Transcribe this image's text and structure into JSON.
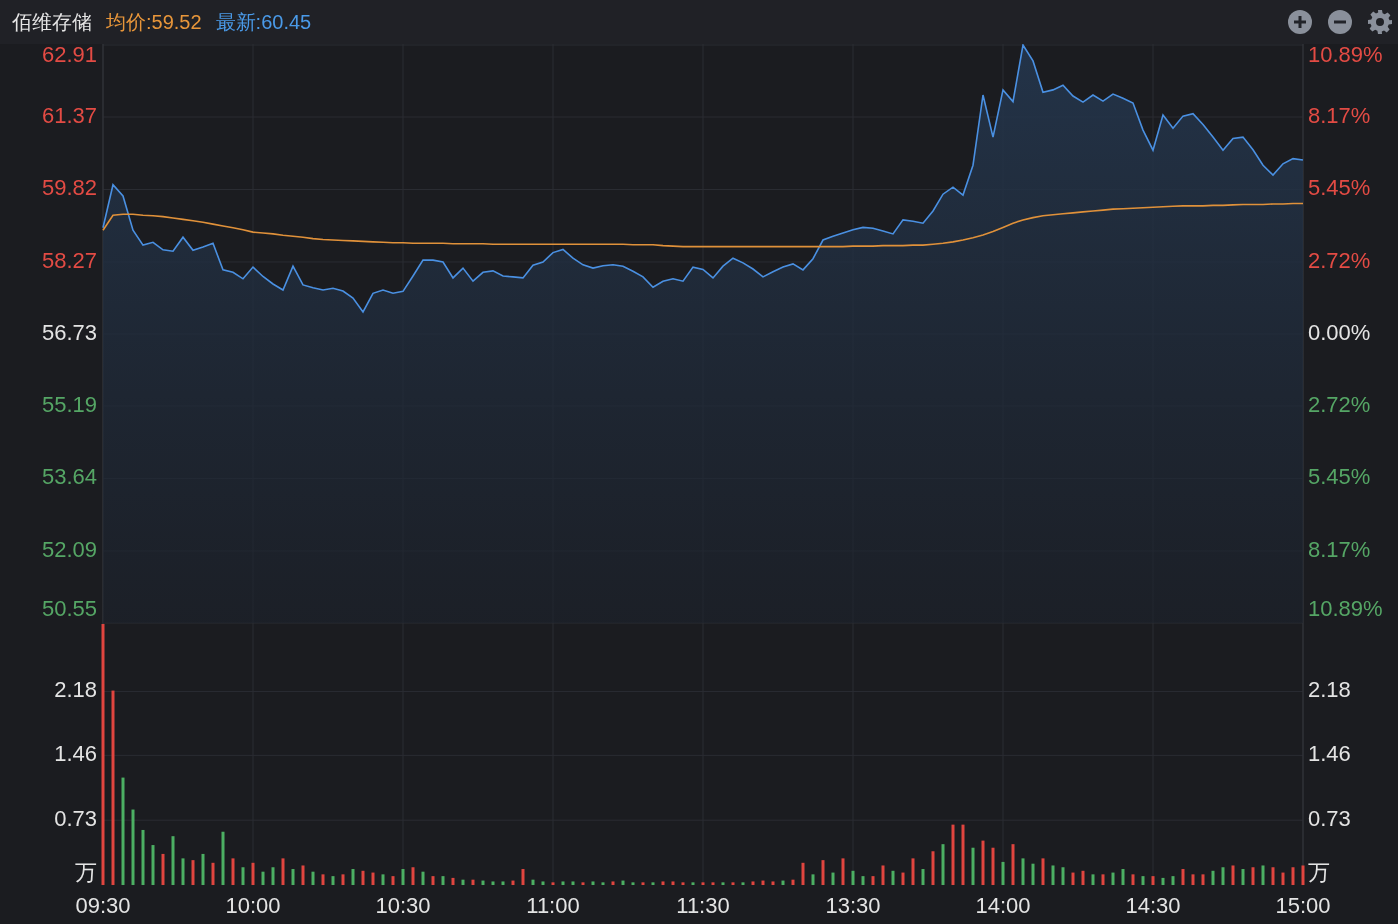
{
  "header": {
    "title": "佰维存储",
    "average": "均价:59.52",
    "latest": "最新:60.45",
    "tools": [
      {
        "kind": "zoom_in"
      },
      {
        "kind": "zoom_out"
      },
      {
        "kind": "settings"
      }
    ]
  },
  "price_chart": {
    "chart_data": {
      "type": "area",
      "grid": true,
      "ylim": [
        50.55,
        62.91
      ],
      "yticks": [
        {
          "value": 62.91,
          "label": "62.91"
        },
        {
          "value": 61.37,
          "label": "61.37"
        },
        {
          "value": 59.82,
          "label": "59.82"
        },
        {
          "value": 58.27,
          "label": "58.27"
        },
        {
          "value": 56.73,
          "label": "56.73"
        },
        {
          "value": 55.19,
          "label": "55.19"
        },
        {
          "value": 53.64,
          "label": "53.64"
        },
        {
          "value": 52.09,
          "label": "52.09"
        },
        {
          "value": 50.55,
          "label": "50.55"
        }
      ],
      "categories": [
        null,
        null,
        null,
        null,
        null,
        null,
        null,
        null,
        null,
        null,
        null,
        null,
        null,
        null,
        null,
        null,
        null,
        null,
        null,
        null,
        null,
        null,
        null,
        null,
        null,
        null,
        null,
        null,
        null,
        null,
        null,
        null,
        null,
        null,
        null,
        null,
        null,
        null,
        null,
        null,
        null,
        null,
        null,
        null,
        null,
        null,
        null,
        null,
        null,
        null,
        null,
        null,
        null,
        null,
        null,
        null,
        null,
        null,
        null,
        null,
        null,
        null,
        null,
        null,
        null,
        null,
        null,
        null,
        null,
        null,
        null,
        null,
        null,
        null,
        null,
        null,
        null,
        null,
        null,
        null,
        null,
        null,
        null,
        null,
        null,
        null,
        null,
        null,
        null,
        null,
        null,
        null,
        null,
        null,
        null,
        null,
        null,
        null,
        null,
        null,
        null,
        null,
        null,
        null,
        null,
        null,
        null,
        null,
        null,
        null,
        null,
        null,
        null,
        null,
        null,
        null,
        null,
        null,
        null,
        null,
        null
      ],
      "series": [
        {
          "color": "#4a90e2",
          "values": [
            59.0,
            59.92,
            59.68,
            58.95,
            58.63,
            58.69,
            58.53,
            58.5,
            58.8,
            58.52,
            58.59,
            58.67,
            58.1,
            58.05,
            57.91,
            58.16,
            57.96,
            57.8,
            57.67,
            58.18,
            57.78,
            57.72,
            57.67,
            57.71,
            57.65,
            57.5,
            57.2,
            57.6,
            57.67,
            57.6,
            57.64,
            57.97,
            58.31,
            58.31,
            58.27,
            57.93,
            58.14,
            57.86,
            58.05,
            58.08,
            57.97,
            57.95,
            57.93,
            58.2,
            58.27,
            58.47,
            58.54,
            58.35,
            58.21,
            58.14,
            58.19,
            58.21,
            58.18,
            58.07,
            57.95,
            57.73,
            57.86,
            57.91,
            57.86,
            58.16,
            58.11,
            57.93,
            58.18,
            58.35,
            58.25,
            58.12,
            57.95,
            58.06,
            58.16,
            58.23,
            58.1,
            58.34,
            58.74,
            58.82,
            58.89,
            58.96,
            59.01,
            58.99,
            58.93,
            58.87,
            59.17,
            59.14,
            59.1,
            59.36,
            59.72,
            59.87,
            59.7,
            60.34,
            61.84,
            60.94,
            61.95,
            61.7,
            62.91,
            62.57,
            61.9,
            61.95,
            62.05,
            61.82,
            61.69,
            61.84,
            61.71,
            61.86,
            61.77,
            61.67,
            61.09,
            60.66,
            61.41,
            61.13,
            61.39,
            61.44,
            61.21,
            60.94,
            60.66,
            60.91,
            60.94,
            60.67,
            60.34,
            60.13,
            60.37,
            60.48,
            60.45
          ]
        },
        {
          "type": "line",
          "color": "#e0913a",
          "values": [
            58.95,
            59.27,
            59.29,
            59.29,
            59.27,
            59.26,
            59.24,
            59.21,
            59.18,
            59.15,
            59.12,
            59.08,
            59.04,
            59.0,
            58.96,
            58.91,
            58.89,
            58.87,
            58.84,
            58.82,
            58.8,
            58.77,
            58.75,
            58.74,
            58.73,
            58.72,
            58.71,
            58.7,
            58.69,
            58.68,
            58.68,
            58.67,
            58.67,
            58.67,
            58.67,
            58.66,
            58.66,
            58.66,
            58.66,
            58.65,
            58.65,
            58.65,
            58.65,
            58.65,
            58.65,
            58.65,
            58.65,
            58.65,
            58.65,
            58.65,
            58.65,
            58.65,
            58.65,
            58.64,
            58.64,
            58.64,
            58.62,
            58.61,
            58.6,
            58.6,
            58.6,
            58.6,
            58.6,
            58.6,
            58.6,
            58.6,
            58.6,
            58.6,
            58.6,
            58.6,
            58.6,
            58.6,
            58.6,
            58.6,
            58.6,
            58.61,
            58.61,
            58.61,
            58.62,
            58.62,
            58.62,
            58.63,
            58.63,
            58.65,
            58.67,
            58.7,
            58.74,
            58.79,
            58.85,
            58.92,
            59.01,
            59.1,
            59.17,
            59.22,
            59.26,
            59.28,
            59.3,
            59.32,
            59.34,
            59.36,
            59.38,
            59.4,
            59.41,
            59.42,
            59.43,
            59.44,
            59.45,
            59.46,
            59.47,
            59.47,
            59.47,
            59.48,
            59.48,
            59.49,
            59.5,
            59.5,
            59.5,
            59.51,
            59.51,
            59.52,
            59.52
          ]
        }
      ]
    },
    "right_axis_labels": [
      {
        "label": "10.89%",
        "kind": "up"
      },
      {
        "label": "8.17%",
        "kind": "up"
      },
      {
        "label": "5.45%",
        "kind": "up"
      },
      {
        "label": "2.72%",
        "kind": "up"
      },
      {
        "label": "0.00%",
        "kind": "flat"
      },
      {
        "label": "2.72%",
        "kind": "down"
      },
      {
        "label": "5.45%",
        "kind": "down"
      },
      {
        "label": "8.17%",
        "kind": "down"
      },
      {
        "label": "10.89%",
        "kind": "down"
      }
    ]
  },
  "volume_chart": {
    "chart_data": {
      "type": "bar",
      "stacked": true,
      "grid": true,
      "ylabel": "万",
      "ylim": [
        0,
        2.94
      ],
      "categories": [
        "09:30",
        null,
        null,
        null,
        null,
        null,
        null,
        null,
        null,
        null,
        null,
        null,
        null,
        null,
        null,
        "10:00",
        null,
        null,
        null,
        null,
        null,
        null,
        null,
        null,
        null,
        null,
        null,
        null,
        null,
        null,
        "10:30",
        null,
        null,
        null,
        null,
        null,
        null,
        null,
        null,
        null,
        null,
        null,
        null,
        null,
        null,
        "11:00",
        null,
        null,
        null,
        null,
        null,
        null,
        null,
        null,
        null,
        null,
        null,
        null,
        null,
        null,
        "11:30",
        null,
        null,
        null,
        null,
        null,
        null,
        null,
        null,
        null,
        null,
        null,
        null,
        null,
        null,
        "13:30",
        null,
        null,
        null,
        null,
        null,
        null,
        null,
        null,
        null,
        null,
        null,
        null,
        null,
        null,
        "14:00",
        null,
        null,
        null,
        null,
        null,
        null,
        null,
        null,
        null,
        null,
        null,
        null,
        null,
        null,
        "14:30",
        null,
        null,
        null,
        null,
        null,
        null,
        null,
        null,
        null,
        null,
        null,
        null,
        null,
        null,
        "15:00"
      ],
      "yticks": [
        {
          "value": 0.73,
          "label": "0.73"
        },
        {
          "value": 1.46,
          "label": "1.46"
        },
        {
          "value": 2.18,
          "label": "2.18"
        }
      ],
      "series": [
        {
          "color": "#e0453f",
          "values": [
            2.94,
            2.19,
            null,
            null,
            null,
            null,
            0.35,
            null,
            null,
            0.28,
            null,
            0.25,
            null,
            0.3,
            null,
            0.25,
            null,
            null,
            0.3,
            null,
            0.22,
            null,
            0.12,
            null,
            0.12,
            null,
            0.16,
            0.14,
            null,
            0.1,
            null,
            0.2,
            null,
            0.1,
            null,
            0.08,
            null,
            0.06,
            null,
            null,
            null,
            0.05,
            0.18,
            null,
            null,
            0.03,
            null,
            null,
            0.03,
            null,
            null,
            0.04,
            null,
            null,
            0.03,
            null,
            0.04,
            0.04,
            0.03,
            null,
            0.03,
            0.03,
            null,
            0.03,
            null,
            0.04,
            0.05,
            0.04,
            null,
            0.06,
            0.25,
            null,
            0.28,
            null,
            0.3,
            null,
            null,
            0.1,
            0.22,
            null,
            0.14,
            0.3,
            null,
            0.38,
            null,
            0.68,
            0.68,
            null,
            0.5,
            0.42,
            null,
            0.46,
            null,
            null,
            0.3,
            null,
            null,
            0.14,
            0.16,
            null,
            0.12,
            null,
            null,
            0.12,
            null,
            0.1,
            null,
            null,
            0.18,
            0.12,
            0.12,
            null,
            null,
            0.22,
            null,
            0.2,
            null,
            0.2,
            0.14,
            0.2,
            0.22
          ]
        },
        {
          "color": "#4caf63",
          "values": [
            null,
            null,
            1.21,
            0.85,
            0.62,
            0.45,
            null,
            0.55,
            0.3,
            null,
            0.35,
            null,
            0.6,
            null,
            0.2,
            null,
            0.15,
            0.2,
            null,
            0.18,
            null,
            0.15,
            null,
            0.1,
            null,
            0.18,
            null,
            null,
            0.12,
            null,
            0.18,
            null,
            0.15,
            null,
            0.1,
            null,
            0.06,
            null,
            0.05,
            0.04,
            0.04,
            null,
            null,
            0.06,
            0.04,
            null,
            0.04,
            0.04,
            null,
            0.04,
            0.03,
            null,
            0.05,
            0.03,
            null,
            0.03,
            null,
            null,
            null,
            0.03,
            null,
            null,
            0.03,
            null,
            0.03,
            null,
            null,
            null,
            0.05,
            null,
            null,
            0.12,
            null,
            0.14,
            null,
            0.16,
            0.1,
            null,
            null,
            0.16,
            null,
            null,
            0.18,
            null,
            0.46,
            null,
            null,
            0.42,
            null,
            null,
            0.26,
            null,
            0.3,
            0.24,
            null,
            0.22,
            0.2,
            null,
            null,
            0.12,
            null,
            0.14,
            0.18,
            null,
            0.1,
            null,
            0.08,
            0.1,
            null,
            null,
            null,
            0.16,
            0.2,
            null,
            0.18,
            null,
            0.22,
            null,
            null,
            null,
            null
          ]
        }
      ]
    },
    "right_axis_labels": [
      "2.18",
      "1.46",
      "0.73",
      "万"
    ]
  }
}
